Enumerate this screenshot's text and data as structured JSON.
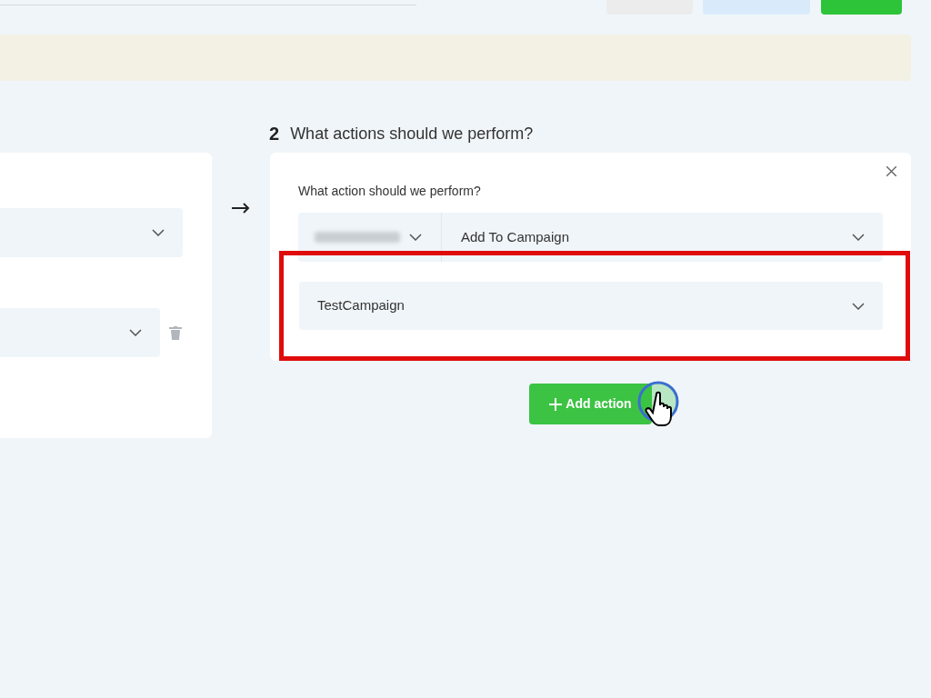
{
  "step": {
    "number": "2",
    "title": "What actions should we perform?"
  },
  "action": {
    "label": "What action should we perform?",
    "action_type": "Add To Campaign",
    "campaign": "TestCampaign"
  },
  "add_button": {
    "label": "Add action"
  }
}
